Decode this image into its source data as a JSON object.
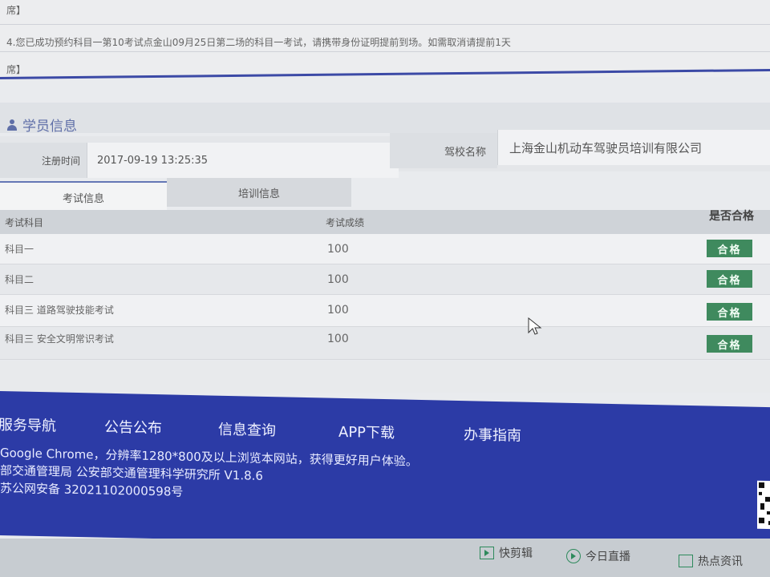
{
  "notice": {
    "line1": "席】",
    "line2": "4.您已成功预约科目一第10考试点金山09月25日第二场的科目一考试，请携带身份证明提前到场。如需取消请提前1天",
    "line3": "席】"
  },
  "student_info": {
    "title": "学员信息",
    "reg_time_label": "注册时间",
    "reg_time_value": "2017-09-19 13:25:35",
    "school_label": "驾校名称",
    "school_value": "上海金山机动车驾驶员培训有限公司"
  },
  "tabs": [
    {
      "label": "考试信息",
      "active": true
    },
    {
      "label": "培训信息",
      "active": false
    }
  ],
  "table": {
    "headers": [
      "考试科目",
      "考试成绩",
      "是否合格"
    ],
    "rows": [
      {
        "subject": "科目一",
        "score": "100",
        "result": "合格"
      },
      {
        "subject": "科目二",
        "score": "100",
        "result": "合格"
      },
      {
        "subject": "科目三 道路驾驶技能考试",
        "score": "100",
        "result": "合格"
      },
      {
        "subject": "科目三 安全文明常识考试",
        "score": "100",
        "result": "合格"
      }
    ]
  },
  "footer": {
    "nav": [
      "服务导航",
      "公告公布",
      "信息查询",
      "APP下载",
      "办事指南"
    ],
    "line1": "Google Chrome，分辨率1280*800及以上浏览本网站，获得更好用户体验。",
    "line2": "部交通管理局 公安部交通管理科学研究所 V1.8.6",
    "line3": "苏公网安备 32021102000598号"
  },
  "bottom_bar": {
    "items": [
      {
        "label": "快剪辑",
        "icon": "play-icon"
      },
      {
        "label": "今日直播",
        "icon": "live-icon"
      },
      {
        "label": "热点资讯",
        "icon": "news-icon"
      }
    ]
  },
  "colors": {
    "footer_bg": "#2c3ba6",
    "pass_badge": "#3f8a5e",
    "title_blue": "#5f6fa8"
  }
}
